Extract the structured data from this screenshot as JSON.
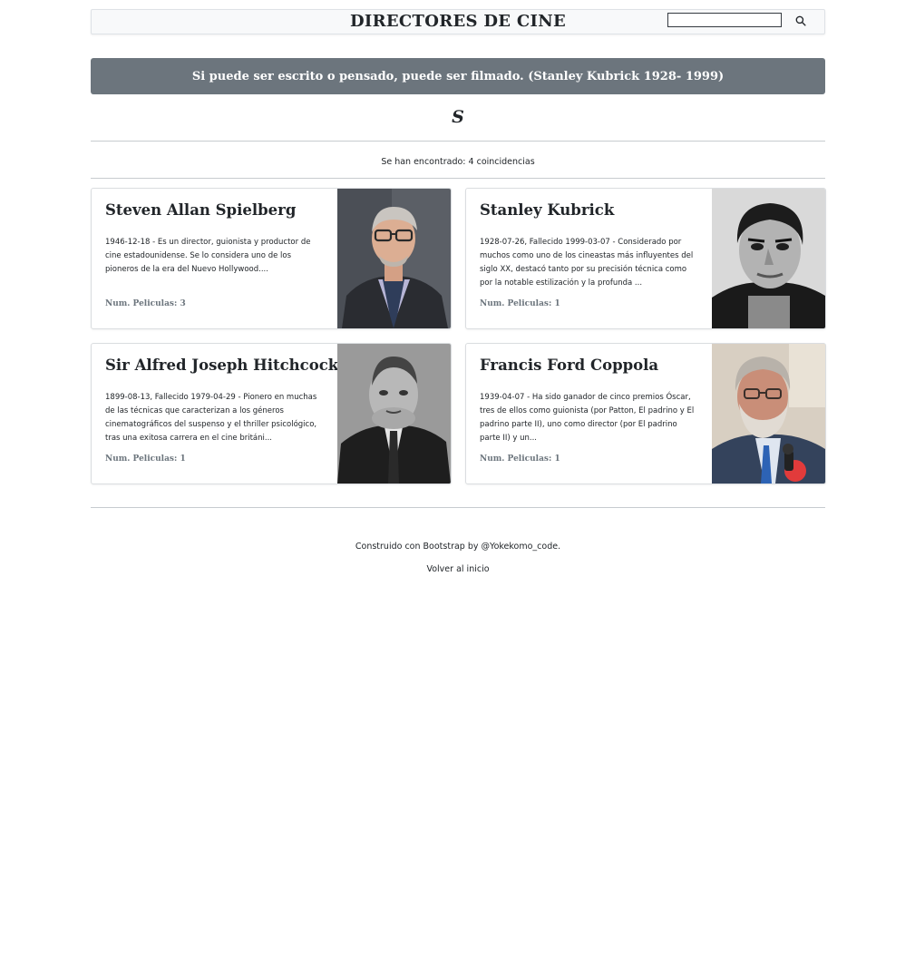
{
  "navbar": {
    "brand": "DIRECTORES DE CINE",
    "search_value": "",
    "search_icon": "search-icon"
  },
  "quote": "Si puede ser escrito o pensado, puede ser filmado. (Stanley Kubrick 1928- 1999)",
  "letter_heading": "S",
  "results_text": "Se han encontrado: 4 coincidencias",
  "directors": [
    {
      "name": "Steven Allan Spielberg",
      "description": "1946-12-18 - Es un director, guionista y productor de cine estadounidense. Se lo considera uno de los pioneros de la era del Nuevo Hollywood....",
      "films": "Num. Peliculas: 3",
      "photo": "steven-spielberg-photo"
    },
    {
      "name": "Stanley Kubrick",
      "description": "1928-07-26, Fallecido 1999-03-07 - Considerado por muchos como uno de los cineastas más influyentes del siglo XX, destacó tanto por su precisión técnica como por la notable estilización y la profunda ...",
      "films": "Num. Peliculas: 1",
      "photo": "stanley-kubrick-photo"
    },
    {
      "name": "Sir Alfred Joseph Hitchcock",
      "description": "1899-08-13, Fallecido 1979-04-29 - Pionero en muchas de las técnicas que caracterizan a los géneros cinematográficos del suspenso y el thriller psicológico, tras una exitosa carrera en el cine británi...",
      "films": "Num. Peliculas: 1",
      "photo": "alfred-hitchcock-photo"
    },
    {
      "name": "Francis Ford Coppola",
      "description": "1939-04-07 - Ha sido ganador de cinco premios Óscar, tres de ellos como guionista (por Patton, El padrino y El padrino parte II), uno como director (por El padrino parte II) y un...",
      "films": "Num. Peliculas: 1",
      "photo": "francis-coppola-photo"
    }
  ],
  "footer": {
    "credit": "Construido con Bootstrap by @Yokekomo_code.",
    "back_link": "Volver al inicio"
  },
  "colors": {
    "quote_bg": "#6c757d",
    "navbar_bg": "#f8f9fa",
    "muted": "#6c757d"
  }
}
